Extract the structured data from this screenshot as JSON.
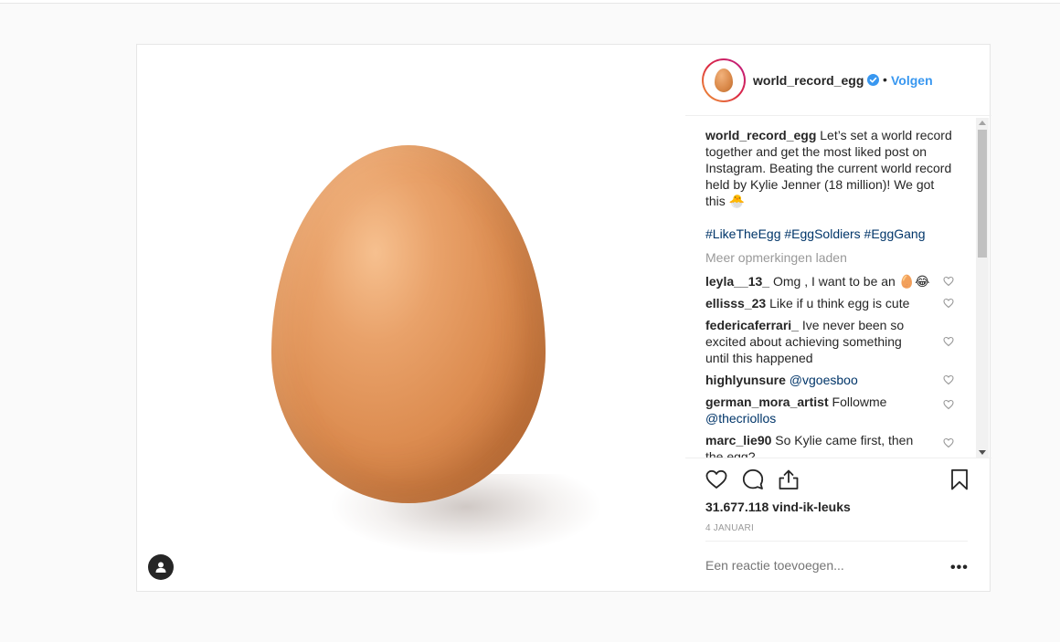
{
  "post": {
    "author": "world_record_egg",
    "separator": "•",
    "follow_label": "Volgen",
    "caption_text": "Let’s set a world record together and get the most liked post on Instagram. Beating the current world record held by Kylie Jenner (18 million)! We got this 🐣",
    "hashtags": "#LikeTheEgg #EggSoldiers #EggGang",
    "load_more": "Meer opmerkingen laden",
    "likes": "31.677.118 vind-ik-leuks",
    "date": "4 JANUARI",
    "add_comment_placeholder": "Een reactie toevoegen...",
    "more_options": "•••"
  },
  "comments": [
    {
      "user": "leyla__13_",
      "text": "Omg , I want to be an 🥚😂"
    },
    {
      "user": "ellisss_23",
      "text": "Like if u think egg is cute"
    },
    {
      "user": "federicaferrari_",
      "text": "Ive never been so excited about achieving something until this happened"
    },
    {
      "user": "highlyunsure",
      "text": "@vgoesboo"
    },
    {
      "user": "german_mora_artist",
      "text": "Followme",
      "mention": "@thecriollos"
    },
    {
      "user": "marc_lie90",
      "text": "So Kylie came first, then the egg?"
    }
  ],
  "colors": {
    "link_blue": "#3897f0",
    "hashtag": "#003569",
    "muted": "#999999"
  }
}
